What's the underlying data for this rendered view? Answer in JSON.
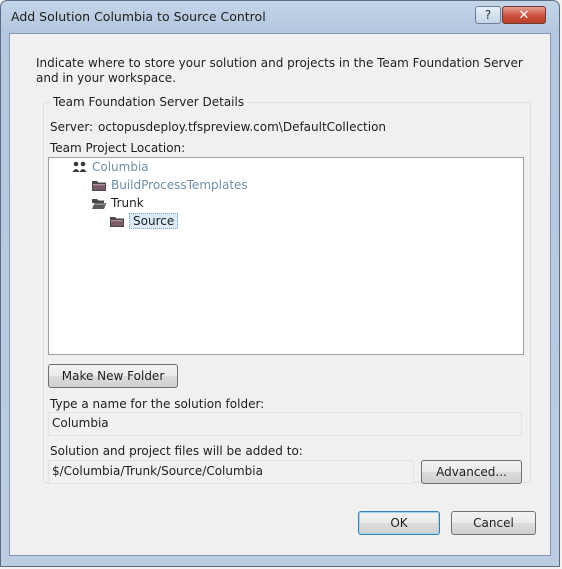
{
  "window": {
    "title": "Add Solution Columbia to Source Control",
    "help_glyph": "?",
    "close_glyph": "✕"
  },
  "background_text": "i",
  "instructions": "Indicate where to store your solution and projects in the Team Foundation Server and in your workspace.",
  "group": {
    "title": "Team Foundation Server Details",
    "server_label": "Server:",
    "server_value": "octopusdeploy.tfspreview.com\\DefaultCollection",
    "location_label": "Team Project Location:"
  },
  "tree": {
    "nodes": [
      {
        "label": "Columbia",
        "icon": "team-project-icon"
      },
      {
        "label": "BuildProcessTemplates",
        "icon": "folder-icon"
      },
      {
        "label": "Trunk",
        "icon": "folder-open-icon"
      },
      {
        "label": "Source",
        "icon": "folder-icon",
        "selected": true
      }
    ]
  },
  "make_folder_button": "Make New Folder",
  "solution_folder": {
    "label": "Type a name for the solution folder:",
    "value": "Columbia"
  },
  "target_path": {
    "label": "Solution and project files will be added to:",
    "value": "$/Columbia/Trunk/Source/Columbia"
  },
  "advanced_button": "Advanced...",
  "ok_button": "OK",
  "cancel_button": "Cancel",
  "colors": {
    "frame": "#bccde3",
    "dim_text": "#6f8fa8",
    "selection": "#dceaf8"
  }
}
